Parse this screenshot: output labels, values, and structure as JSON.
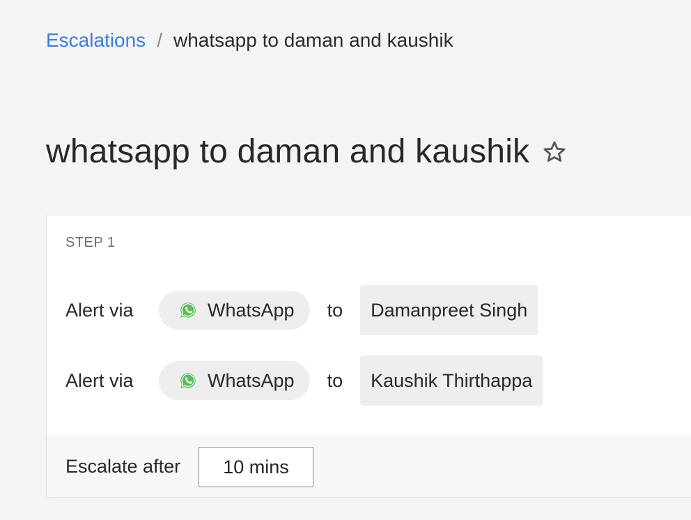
{
  "breadcrumb": {
    "parent": "Escalations",
    "separator": "/",
    "current": "whatsapp to daman and kaushik"
  },
  "page": {
    "title": "whatsapp to daman and kaushik",
    "star_icon": "star-outline-icon"
  },
  "step": {
    "label": "STEP 1",
    "alerts": [
      {
        "prefix": "Alert via",
        "channel": "WhatsApp",
        "channel_icon": "whatsapp-icon",
        "connector": "to",
        "recipient": "Damanpreet Singh"
      },
      {
        "prefix": "Alert via",
        "channel": "WhatsApp",
        "channel_icon": "whatsapp-icon",
        "connector": "to",
        "recipient": "Kaushik Thirthappa"
      }
    ],
    "escalate": {
      "label": "Escalate after",
      "value": "10 mins"
    }
  },
  "colors": {
    "link": "#3b7fe0",
    "whatsapp": "#59c15a",
    "background": "#f4f4f4"
  }
}
